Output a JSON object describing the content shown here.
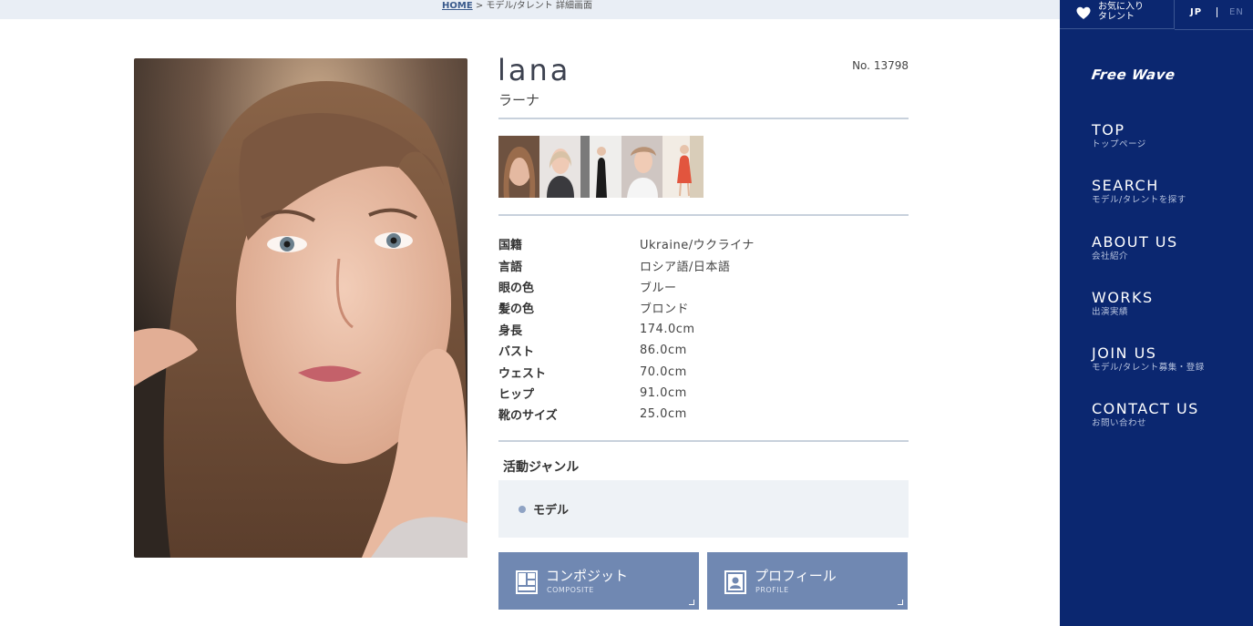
{
  "breadcrumb": {
    "home": "HOME",
    "separator": ">",
    "current": "モデル/タレント 詳細画面"
  },
  "profile": {
    "name_en": "lana",
    "name_jp": "ラーナ",
    "number": "No. 13798",
    "thumbnail_count": 5,
    "specs": [
      {
        "label": "国籍",
        "value": "Ukraine/ウクライナ"
      },
      {
        "label": "言語",
        "value": "ロシア語/日本語"
      },
      {
        "label": "眼の色",
        "value": "ブルー"
      },
      {
        "label": "髪の色",
        "value": "ブロンド"
      },
      {
        "label": "身長",
        "value": "174.0cm"
      },
      {
        "label": "バスト",
        "value": "86.0cm"
      },
      {
        "label": "ウェスト",
        "value": "70.0cm"
      },
      {
        "label": "ヒップ",
        "value": "91.0cm"
      },
      {
        "label": "靴のサイズ",
        "value": "25.0cm"
      }
    ],
    "genre_title": "活動ジャンル",
    "genres": [
      "モデル"
    ]
  },
  "buttons": {
    "composite": {
      "label": "コンポジット",
      "sub": "COMPOSITE",
      "icon": "composite-icon"
    },
    "profile": {
      "label": "プロフィール",
      "sub": "PROFILE",
      "icon": "profile-card-icon"
    }
  },
  "sidebar": {
    "favorites_label_line1": "お気に入り",
    "favorites_label_line2": "タレント",
    "lang_jp": "JP",
    "lang_en": "EN",
    "logo": "Free Wave",
    "nav": [
      {
        "en": "TOP",
        "jp": "トップページ"
      },
      {
        "en": "SEARCH",
        "jp": "モデル/タレントを探す"
      },
      {
        "en": "ABOUT US",
        "jp": "会社紹介"
      },
      {
        "en": "WORKS",
        "jp": "出演実績"
      },
      {
        "en": "JOIN US",
        "jp": "モデル/タレント募集・登録"
      },
      {
        "en": "CONTACT US",
        "jp": "お問い合わせ"
      }
    ]
  },
  "colors": {
    "sidebar_bg": "#0b2770",
    "button_bg": "#7088b2",
    "genre_bg": "#eef2f6",
    "breadcrumb_bg": "#e9eef5"
  }
}
